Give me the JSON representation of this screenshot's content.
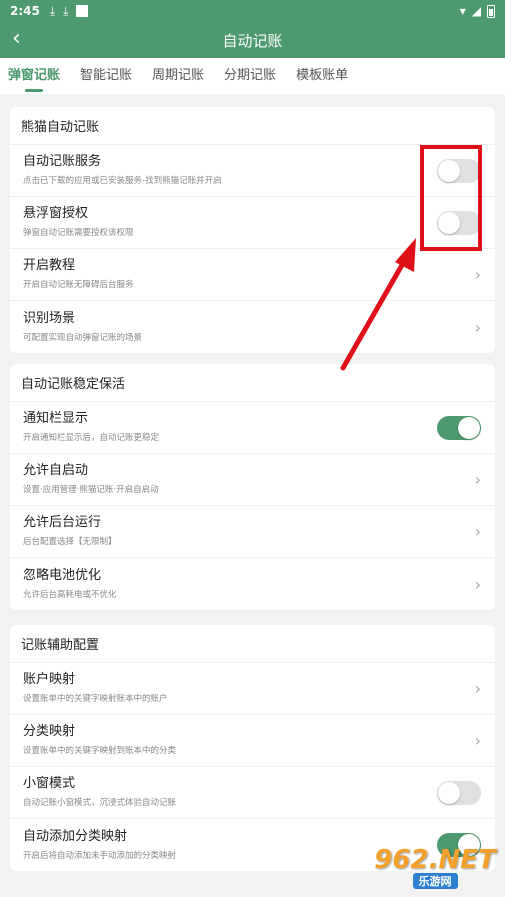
{
  "status_bar": {
    "time": "2:45"
  },
  "app_bar": {
    "title": "自动记账",
    "back_icon": "arrow-left-icon"
  },
  "tabs": [
    {
      "label": "弹窗记账",
      "active": true
    },
    {
      "label": "智能记账",
      "active": false
    },
    {
      "label": "周期记账",
      "active": false
    },
    {
      "label": "分期记账",
      "active": false
    },
    {
      "label": "模板账单",
      "active": false
    }
  ],
  "sections": [
    {
      "header": "熊猫自动记账",
      "rows": [
        {
          "title": "自动记账服务",
          "subtitle": "点击已下载的应用或已安装服务-找到熊猫记账并开启",
          "control": "toggle",
          "on": false
        },
        {
          "title": "悬浮窗授权",
          "subtitle": "弹窗自动记账需要授权该权限",
          "control": "toggle",
          "on": false
        },
        {
          "title": "开启教程",
          "subtitle": "开启自动记账无障碍后台服务",
          "control": "chevron"
        },
        {
          "title": "识别场景",
          "subtitle": "可配置实现自动弹窗记账的场景",
          "control": "chevron"
        }
      ]
    },
    {
      "header": "自动记账稳定保活",
      "rows": [
        {
          "title": "通知栏显示",
          "subtitle": "开启通知栏显示后，自动记账更稳定",
          "control": "toggle",
          "on": true
        },
        {
          "title": "允许自启动",
          "subtitle": "设置·应用管理·熊猫记账·开启自启动",
          "control": "chevron"
        },
        {
          "title": "允许后台运行",
          "subtitle": "后台配置选择【无限制】",
          "control": "chevron"
        },
        {
          "title": "忽略电池优化",
          "subtitle": "允许后台高耗电或不优化",
          "control": "chevron"
        }
      ]
    },
    {
      "header": "记账辅助配置",
      "rows": [
        {
          "title": "账户映射",
          "subtitle": "设置账单中的关键字映射账本中的账户",
          "control": "chevron"
        },
        {
          "title": "分类映射",
          "subtitle": "设置账单中的关键字映射到账本中的分类",
          "control": "chevron"
        },
        {
          "title": "小窗模式",
          "subtitle": "自动记账小窗模式，沉浸式体验自动记账",
          "control": "toggle",
          "on": false
        },
        {
          "title": "自动添加分类映射",
          "subtitle": "开启后将自动添加未手动添加的分类映射",
          "control": "toggle",
          "on": true
        }
      ]
    }
  ],
  "colors": {
    "accent": "#4c9a6e",
    "highlight": "#e0101a"
  },
  "watermark": {
    "brand": "962.NET",
    "sub": "乐游网"
  }
}
